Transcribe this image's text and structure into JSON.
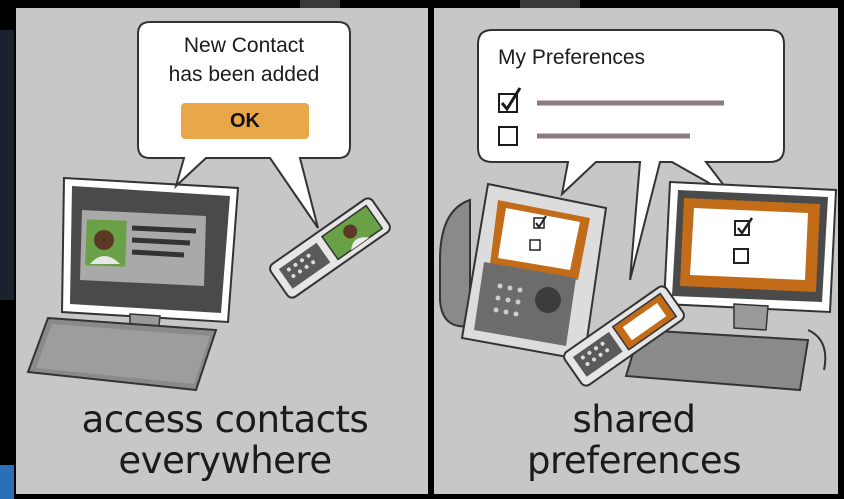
{
  "left_panel": {
    "notification": {
      "line1": "New Contact",
      "line2": "has been added",
      "ok_label": "OK"
    },
    "caption_line1": "access contacts",
    "caption_line2": "everywhere"
  },
  "right_panel": {
    "preferences": {
      "title": "My Preferences",
      "items": [
        {
          "checked": true
        },
        {
          "checked": false
        }
      ]
    },
    "caption_line1": "shared",
    "caption_line2": "preferences"
  },
  "colors": {
    "panel_background": "#c7c7c7",
    "button_orange": "#e8a84a",
    "screen_orange": "#c26c19",
    "contact_green": "#6aa046",
    "line_mauve": "#8f7a80"
  }
}
